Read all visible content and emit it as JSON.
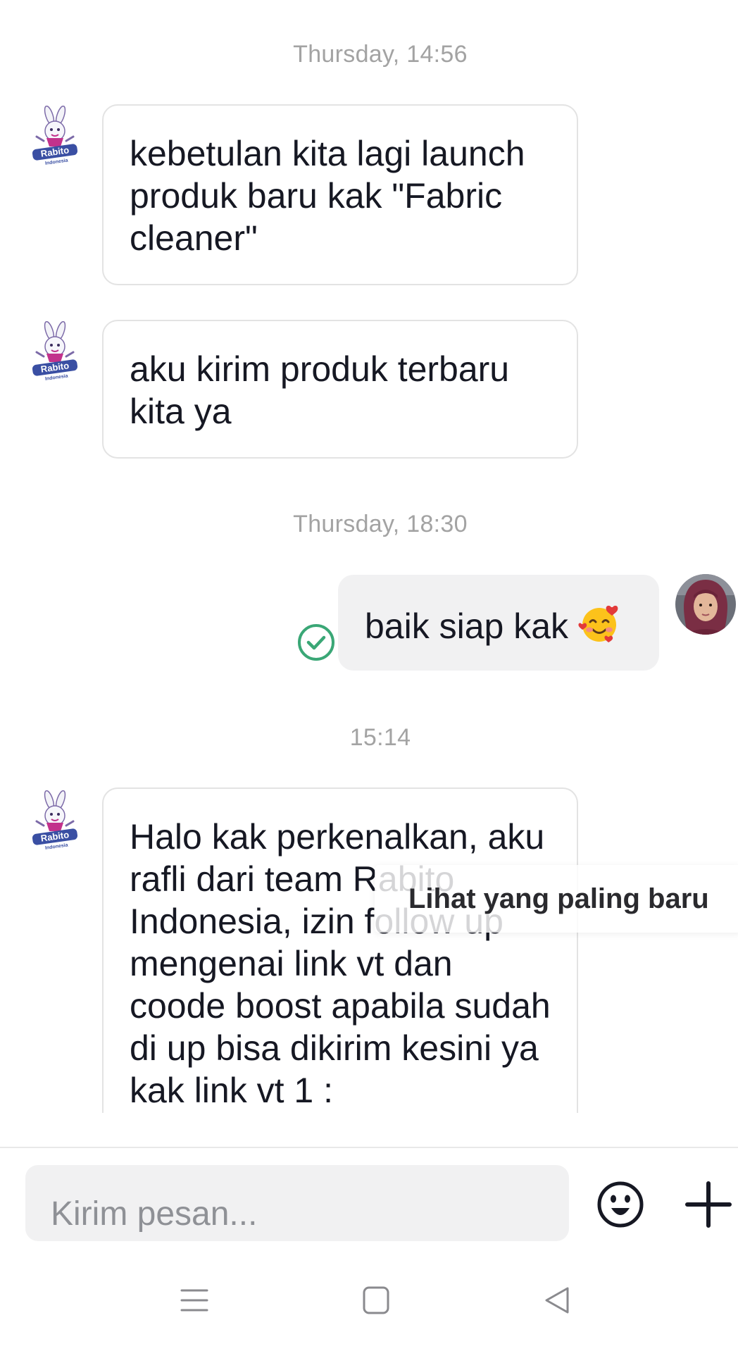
{
  "conversation": {
    "timestamps": [
      "Thursday, 14:56",
      "Thursday, 18:30",
      "15:14"
    ],
    "messages": [
      {
        "from": "brand",
        "text": "kebetulan kita lagi launch produk baru kak \"Fabric cleaner\""
      },
      {
        "from": "brand",
        "text": "aku kirim produk terbaru kita ya"
      },
      {
        "from": "me",
        "text": "baik siap kak",
        "emoji": "smiling-face-with-hearts",
        "status": "sent"
      },
      {
        "from": "brand",
        "text": "Halo kak perkenalkan, aku rafli dari team Rabito Indonesia, izin follow up mengenai link vt dan coode boost apabila sudah di up bisa dikirim kesini ya kak link vt 1 :"
      }
    ],
    "brand_avatar": {
      "name": "Rabito",
      "sub": "Indonesia"
    }
  },
  "jump_to_latest": "Lihat yang paling baru",
  "composer": {
    "placeholder": "Kirim pesan...",
    "emoji_icon": "emoji-icon",
    "add_icon": "plus-icon"
  },
  "navbar": {
    "items": [
      "menu-icon",
      "home-icon",
      "back-icon"
    ]
  },
  "colors": {
    "accent_check": "#3aa776",
    "bubble_out": "#f1f1f2",
    "bubble_border": "#e3e3e3",
    "timestamp": "#a3a3a3",
    "brand_purple": "#c2328c",
    "brand_blue": "#3a4fa3"
  }
}
